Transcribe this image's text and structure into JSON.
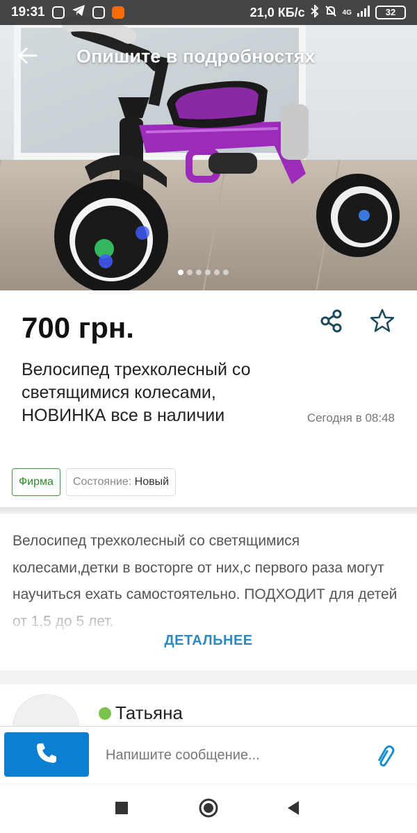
{
  "status_bar": {
    "time": "19:31",
    "network_speed": "21,0 КБ/с",
    "signal": "4G",
    "battery": "32"
  },
  "toolbar": {
    "title": "Опишите в подробностях"
  },
  "gallery": {
    "photo_count": 6,
    "active_index": 0
  },
  "ad": {
    "price": "700 грн.",
    "title": "Велосипед трехколесный со светящимися колесами, НОВИНКА все в наличии",
    "posted": "Сегодня в 08:48",
    "badge_firm": "Фирма",
    "condition_label": "Состояние:",
    "condition_value": "Новый"
  },
  "description": {
    "text": "Велосипед трехколесный со светящимися колесами,детки в восторге от них,с первого раза могут научиться ехать самостоятельно. ПОДХОДИТ для детей от 1,5 до 5 лет.",
    "more_label": "ДЕТАЛЬНЕЕ"
  },
  "seller": {
    "name": "Татьяна",
    "online_color": "#7bc24a"
  },
  "actions": {
    "message_placeholder": "Напишите сообщение...",
    "call_color": "#0d7fd1"
  },
  "icons": {
    "back": "arrow-left-icon",
    "share": "share-icon",
    "favorite": "star-icon",
    "call": "phone-icon",
    "attach": "paperclip-icon"
  }
}
